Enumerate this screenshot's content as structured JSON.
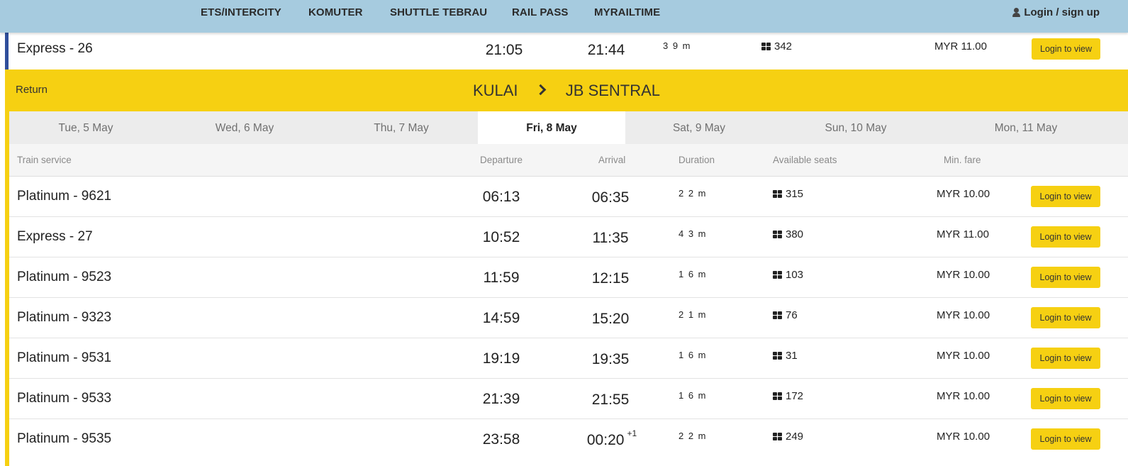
{
  "nav": {
    "items": [
      "ETS/INTERCITY",
      "KOMUTER",
      "SHUTTLE TEBRAU",
      "RAIL PASS",
      "MYRAILTIME"
    ],
    "login": "Login / sign up"
  },
  "previous_row": {
    "service": "Express - 26",
    "departure": "21:05",
    "arrival": "21:44",
    "duration": "3 9 m",
    "seats": "342",
    "fare": "MYR 11.00",
    "button": "Login to view"
  },
  "return_section": {
    "label": "Return",
    "origin": "KULAI",
    "destination": "JB SENTRAL"
  },
  "date_tabs": [
    {
      "label": "Tue, 5 May",
      "active": false
    },
    {
      "label": "Wed, 6 May",
      "active": false
    },
    {
      "label": "Thu, 7 May",
      "active": false
    },
    {
      "label": "Fri, 8 May",
      "active": true
    },
    {
      "label": "Sat, 9 May",
      "active": false
    },
    {
      "label": "Sun, 10 May",
      "active": false
    },
    {
      "label": "Mon, 11 May",
      "active": false
    }
  ],
  "columns": {
    "service": "Train service",
    "departure": "Departure",
    "arrival": "Arrival",
    "duration": "Duration",
    "seats": "Available seats",
    "fare": "Min. fare"
  },
  "trains": [
    {
      "service": "Platinum - 9621",
      "departure": "06:13",
      "arrival": "06:35",
      "next_day": "",
      "duration": "2 2 m",
      "seats": "315",
      "fare": "MYR 10.00",
      "button": "Login to view"
    },
    {
      "service": "Express - 27",
      "departure": "10:52",
      "arrival": "11:35",
      "next_day": "",
      "duration": "4 3 m",
      "seats": "380",
      "fare": "MYR 11.00",
      "button": "Login to view"
    },
    {
      "service": "Platinum - 9523",
      "departure": "11:59",
      "arrival": "12:15",
      "next_day": "",
      "duration": "1 6 m",
      "seats": "103",
      "fare": "MYR 10.00",
      "button": "Login to view"
    },
    {
      "service": "Platinum - 9323",
      "departure": "14:59",
      "arrival": "15:20",
      "next_day": "",
      "duration": "2 1 m",
      "seats": "76",
      "fare": "MYR 10.00",
      "button": "Login to view"
    },
    {
      "service": "Platinum - 9531",
      "departure": "19:19",
      "arrival": "19:35",
      "next_day": "",
      "duration": "1 6 m",
      "seats": "31",
      "fare": "MYR 10.00",
      "button": "Login to view"
    },
    {
      "service": "Platinum - 9533",
      "departure": "21:39",
      "arrival": "21:55",
      "next_day": "",
      "duration": "1 6 m",
      "seats": "172",
      "fare": "MYR 10.00",
      "button": "Login to view"
    },
    {
      "service": "Platinum - 9535",
      "departure": "23:58",
      "arrival": "00:20",
      "next_day": "+1",
      "duration": "2 2 m",
      "seats": "249",
      "fare": "MYR 10.00",
      "button": "Login to view"
    }
  ],
  "colors": {
    "nav_bg": "#a6cbdf",
    "accent_yellow": "#f6d012",
    "prev_bar_blue": "#2f4e9b"
  }
}
